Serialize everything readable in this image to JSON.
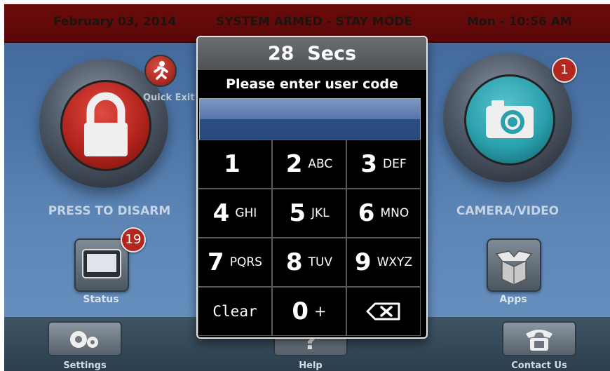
{
  "header": {
    "date": "February 03, 2014",
    "status": "SYSTEM ARMED - STAY MODE",
    "time": "Mon - 10:56 AM"
  },
  "left": {
    "disarm_label": "PRESS TO DISARM",
    "quick_exit_label": "Quick Exit",
    "status_label": "Status",
    "status_badge": "19"
  },
  "right": {
    "camera_label": "CAMERA/VIDEO",
    "camera_badge": "1",
    "apps_label": "Apps"
  },
  "bottom": {
    "settings_label": "Settings",
    "help_label": "Help",
    "contact_label": "Contact Us"
  },
  "dialog": {
    "countdown": "28  Secs",
    "prompt": "Please enter user code",
    "code_value": "",
    "keys": [
      {
        "num": "1",
        "letters": ""
      },
      {
        "num": "2",
        "letters": "ABC"
      },
      {
        "num": "3",
        "letters": "DEF"
      },
      {
        "num": "4",
        "letters": "GHI"
      },
      {
        "num": "5",
        "letters": "JKL"
      },
      {
        "num": "6",
        "letters": "MNO"
      },
      {
        "num": "7",
        "letters": "PQRS"
      },
      {
        "num": "8",
        "letters": "TUV"
      },
      {
        "num": "9",
        "letters": "WXYZ"
      }
    ],
    "clear_label": "Clear",
    "zero_num": "0",
    "zero_letters": "+"
  },
  "colors": {
    "header_bg": "#6d0b0b",
    "lock_red": "#b3241e",
    "camera_teal": "#2aa0ad",
    "badge_red": "#b5261f"
  }
}
